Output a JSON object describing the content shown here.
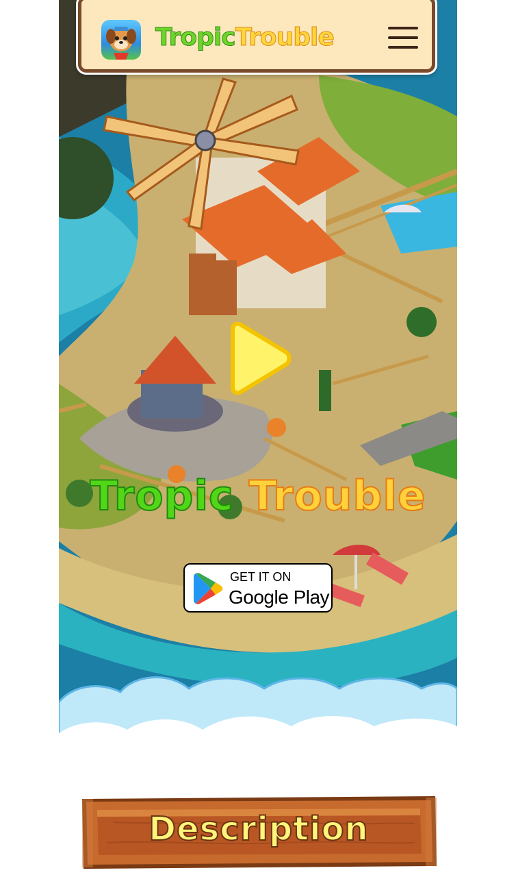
{
  "header": {
    "brand_part1": "Tropic",
    "brand_part2": "Trouble",
    "app_icon": "dog-mascot-icon",
    "menu_icon": "hamburger-menu-icon"
  },
  "hero": {
    "play_icon": "play-triangle-icon",
    "title_part1": "Tropic",
    "title_part2": "Trouble"
  },
  "store_badge": {
    "small_text": "GET IT ON",
    "store_name": "Google Play",
    "icon": "google-play-icon"
  },
  "section": {
    "label": "Description"
  },
  "colors": {
    "green": "#52d618",
    "yellow": "#ffd23c",
    "header_bg": "#fde7bd",
    "wood": "#b55a2a"
  }
}
